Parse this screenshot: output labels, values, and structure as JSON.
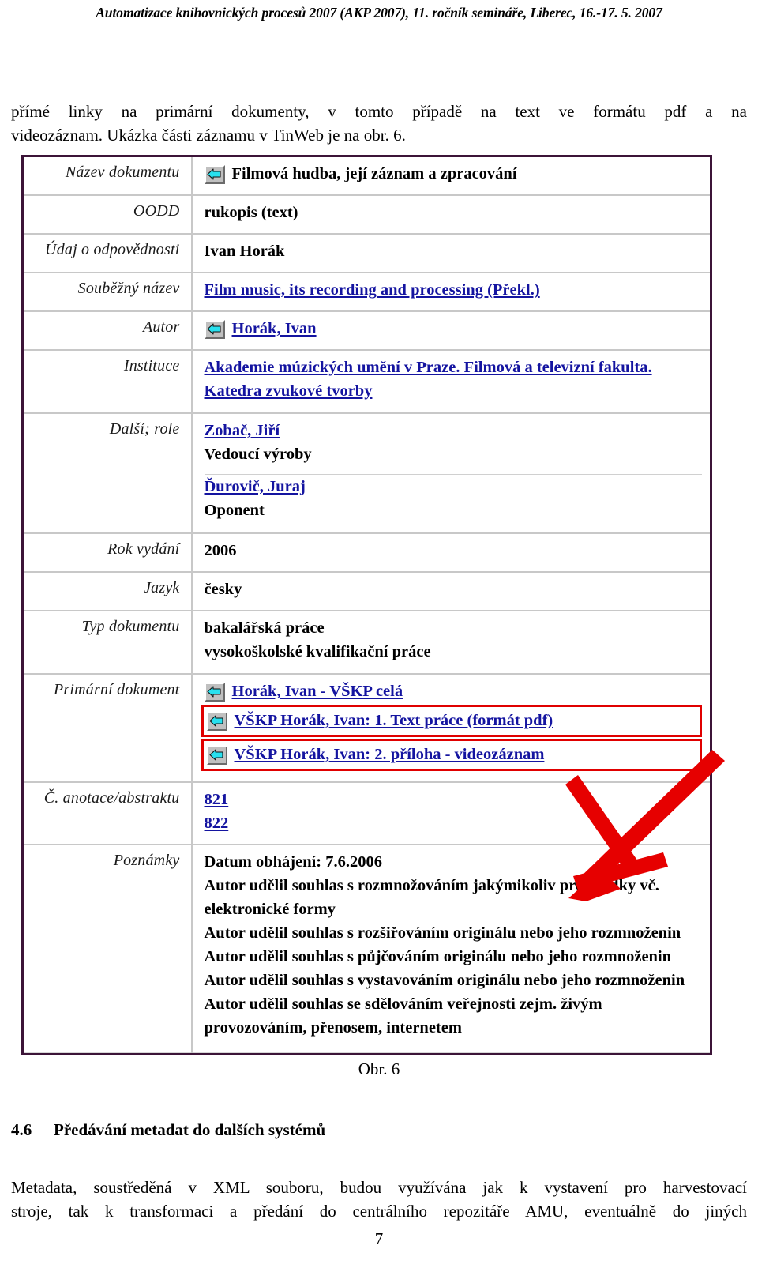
{
  "running_head": "Automatizace knihovnických procesů 2007 (AKP 2007), 11. ročník semináře, Liberec, 16.-17. 5. 2007",
  "intro_paragraph": {
    "line1": "přímé linky na primární dokumenty, v tomto případě na text ve formátu pdf a na",
    "line2": "videozáznam. Ukázka části záznamu v TinWeb je na obr. 6."
  },
  "figure": {
    "caption": "Obr. 6",
    "icon_name": "back-arrow-icon",
    "accent_border_color": "#3c1438",
    "link_color": "#1414a0",
    "highlight_color": "#e00000",
    "rows": [
      {
        "label": "Název dokumentu",
        "has_icon": true,
        "values": [
          {
            "text": "Filmová hudba, její záznam a zpracování",
            "link": false
          }
        ]
      },
      {
        "label": "OODD",
        "has_icon": false,
        "values": [
          {
            "text": "rukopis (text)",
            "link": false
          }
        ]
      },
      {
        "label": "Údaj o odpovědnosti",
        "has_icon": false,
        "values": [
          {
            "text": "Ivan Horák",
            "link": false
          }
        ]
      },
      {
        "label": "Souběžný název",
        "has_icon": false,
        "values": [
          {
            "text": "Film music, its recording and processing (Překl.)",
            "link": true
          }
        ]
      },
      {
        "label": "Autor",
        "has_icon": true,
        "values": [
          {
            "text": "Horák, Ivan",
            "link": true
          }
        ]
      },
      {
        "label": "Instituce",
        "has_icon": false,
        "values": [
          {
            "text": "Akademie múzických umění v Praze. Filmová a televizní fakulta. Katedra zvukové tvorby",
            "link": true
          }
        ]
      },
      {
        "label": "Další; role",
        "has_icon": false,
        "values": [
          {
            "text": "Zobač, Jiří",
            "link": true
          },
          {
            "text": "Vedoucí výroby",
            "link": false
          },
          {
            "text": "Ďurovič, Juraj",
            "link": true,
            "separator_above": true
          },
          {
            "text": "Oponent",
            "link": false
          }
        ]
      },
      {
        "label": "Rok vydání",
        "has_icon": false,
        "values": [
          {
            "text": "2006",
            "link": false
          }
        ]
      },
      {
        "label": "Jazyk",
        "has_icon": false,
        "values": [
          {
            "text": "česky",
            "link": false
          }
        ]
      },
      {
        "label": "Typ dokumentu",
        "has_icon": false,
        "values": [
          {
            "text": "bakalářská práce",
            "link": false
          },
          {
            "text": "vysokoškolské kvalifikační práce",
            "link": false
          }
        ]
      },
      {
        "label": "Primární dokument",
        "has_icon": false,
        "values": [
          {
            "text": "Horák, Ivan - VŠKP celá",
            "link": true,
            "icon": true
          },
          {
            "text": "VŠKP Horák, Ivan: 1. Text práce (formát pdf)",
            "link": true,
            "icon": true,
            "highlighted": true
          },
          {
            "text": "VŠKP Horák, Ivan: 2. příloha - videozáznam",
            "link": true,
            "icon": true,
            "highlighted": true
          }
        ]
      },
      {
        "label": "Č. anotace/abstraktu",
        "has_icon": false,
        "values": [
          {
            "text": "821",
            "link": true
          },
          {
            "text": "822",
            "link": true
          }
        ]
      },
      {
        "label": "Poznámky",
        "has_icon": false,
        "values": [
          {
            "text": "Datum obhájení: 7.6.2006",
            "link": false
          },
          {
            "text": "Autor udělil souhlas s rozmnožováním jakýmikoliv prostředky vč. elektronické formy",
            "link": false
          },
          {
            "text": "Autor udělil souhlas s rozšiřováním originálu nebo jeho rozmnoženin",
            "link": false
          },
          {
            "text": "Autor udělil souhlas s půjčováním originálu nebo jeho rozmnoženin",
            "link": false
          },
          {
            "text": "Autor udělil souhlas s vystavováním originálu nebo jeho rozmnoženin",
            "link": false
          },
          {
            "text": "Autor udělil souhlas se sdělováním veřejnosti zejm. živým provozováním, přenosem, internetem",
            "link": false
          }
        ]
      }
    ]
  },
  "section": {
    "number": "4.6",
    "title": "Předávání metadat do dalších systémů"
  },
  "tail_paragraph": {
    "line1": "Metadata, soustředěná v XML souboru, budou využívána jak k vystavení pro harvestovací",
    "line2": "stroje, tak k transformaci a předání do centrálního repozitáře AMU, eventuálně do jiných"
  },
  "page_number": "7"
}
